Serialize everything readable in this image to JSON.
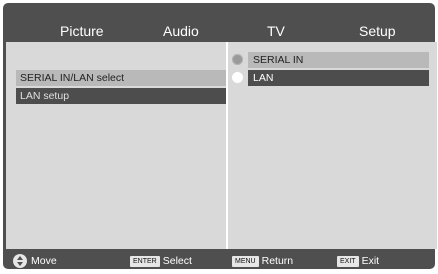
{
  "tabs": [
    "Picture",
    "Audio",
    "TV",
    "Setup"
  ],
  "menu": {
    "items": [
      "SERIAL IN/LAN select",
      "LAN setup"
    ]
  },
  "options": {
    "items": [
      "SERIAL IN",
      "LAN"
    ],
    "selected": "LAN"
  },
  "help": {
    "move": "Move",
    "enter_key": "ENTER",
    "select": "Select",
    "menu_key": "MENU",
    "return": "Return",
    "exit_key": "EXIT",
    "exit": "Exit"
  }
}
